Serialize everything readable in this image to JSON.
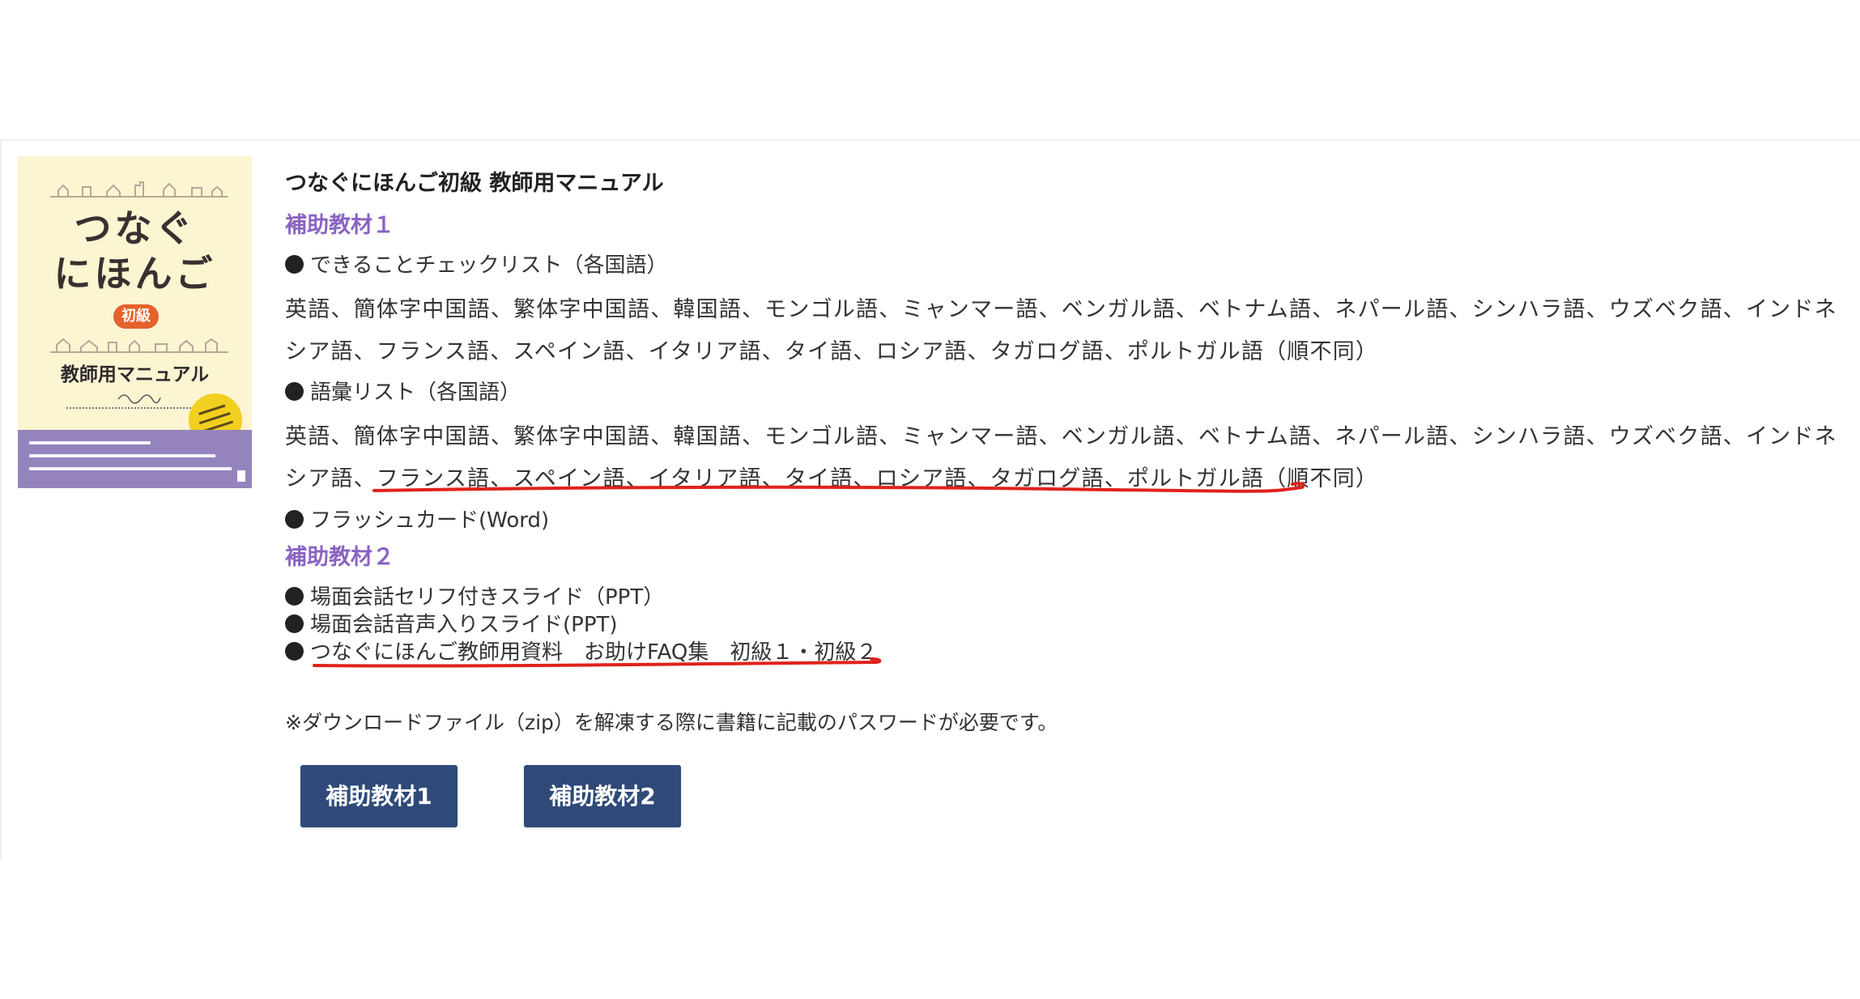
{
  "book": {
    "cover_title_line1": "つなぐ",
    "cover_title_line2": "にほんご",
    "cover_level": "初級",
    "cover_subtitle": "教師用マニュアル",
    "title": "つなぐにほんご初級 教師用マニュアル"
  },
  "material1": {
    "heading": "補助教材１",
    "items": [
      {
        "label": "できることチェックリスト（各国語）",
        "languages_line1": "英語、簡体字中国語、繁体字中国語、韓国語、モンゴル語、ミャンマー語、ベンガル語、ベトナム語、ネパール語、シンハラ語、ウズベク語、インドネ",
        "languages_line2": "シア語、フランス語、スペイン語、イタリア語、タイ語、ロシア語、タガログ語、ポルトガル語（順不同）"
      },
      {
        "label": "語彙リスト（各国語）",
        "languages_line1": "英語、簡体字中国語、繁体字中国語、韓国語、モンゴル語、ミャンマー語、ベンガル語、ベトナム語、ネパール語、シンハラ語、ウズベク語、インドネ",
        "languages_line2": "シア語、フランス語、スペイン語、イタリア語、タイ語、ロシア語、タガログ語、ポルトガル語（順不同）"
      },
      {
        "label": "フラッシュカード(Word)"
      }
    ]
  },
  "material2": {
    "heading": "補助教材２",
    "items": [
      {
        "label": "場面会話セリフ付きスライド（PPT）"
      },
      {
        "label": "場面会話音声入りスライド(PPT)"
      },
      {
        "label": "つなぐにほんご教師用資料　お助けFAQ集　初級１・初級２"
      }
    ]
  },
  "note": "※ダウンロードファイル（zip）を解凍する際に書籍に記載のパスワードが必要です。",
  "buttons": {
    "material1": "補助教材1",
    "material2": "補助教材2"
  },
  "colors": {
    "section_heading": "#8a63c2",
    "button_bg": "#2f4a78",
    "annotation_red": "#e0221b",
    "cover_bg": "#fbf5d2",
    "cover_band": "#9583bd"
  }
}
